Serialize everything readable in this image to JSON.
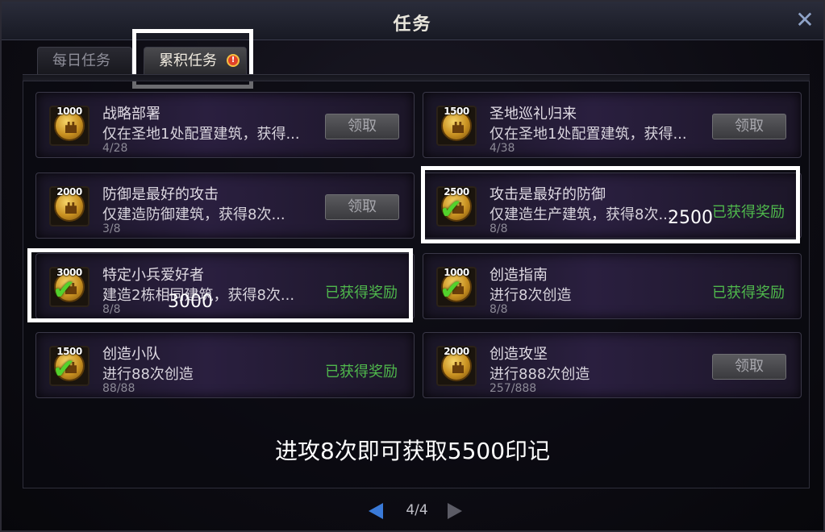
{
  "window": {
    "title": "任务",
    "close_label": "✕"
  },
  "tabs": [
    {
      "label": "每日任务"
    },
    {
      "label": "累积任务",
      "badge": "!"
    }
  ],
  "cards": [
    {
      "title": "战略部署",
      "desc": "仅在圣地1处配置建筑，获得...",
      "progress": "4/28",
      "amount": "1000",
      "status": "claim",
      "button": "领取"
    },
    {
      "title": "圣地巡礼归来",
      "desc": "仅在圣地1处配置建筑，获得...",
      "progress": "4/38",
      "amount": "1500",
      "status": "claim",
      "button": "领取"
    },
    {
      "title": "防御是最好的攻击",
      "desc": "仅建造防御建筑，获得8次...",
      "progress": "3/8",
      "amount": "2000",
      "status": "claim",
      "button": "领取"
    },
    {
      "title": "攻击是最好的防御",
      "desc": "仅建造生产建筑，获得8次...",
      "progress": "8/8",
      "amount": "2500",
      "status": "claimed",
      "claimed_label": "已获得奖励"
    },
    {
      "title": "特定小兵爱好者",
      "desc": "建造2栋相同建筑，获得8次...",
      "progress": "8/8",
      "amount": "3000",
      "status": "claimed",
      "claimed_label": "已获得奖励"
    },
    {
      "title": "创造指南",
      "desc": "进行8次创造",
      "progress": "8/8",
      "amount": "1000",
      "status": "claimed",
      "claimed_label": "已获得奖励"
    },
    {
      "title": "创造小队",
      "desc": "进行88次创造",
      "progress": "88/88",
      "amount": "1500",
      "status": "claimed",
      "claimed_label": "已获得奖励"
    },
    {
      "title": "创造攻坚",
      "desc": "进行888次创造",
      "progress": "257/888",
      "amount": "2000",
      "status": "claim",
      "button": "领取"
    }
  ],
  "annotations": {
    "num_2500": "2500",
    "num_3000": "3000",
    "caption": "进攻8次即可获取5500印记"
  },
  "pager": {
    "label": "4/4"
  },
  "colors": {
    "claimed_green": "#4fb84c",
    "check_green": "#52d22c",
    "highlight": "#ffffff"
  }
}
